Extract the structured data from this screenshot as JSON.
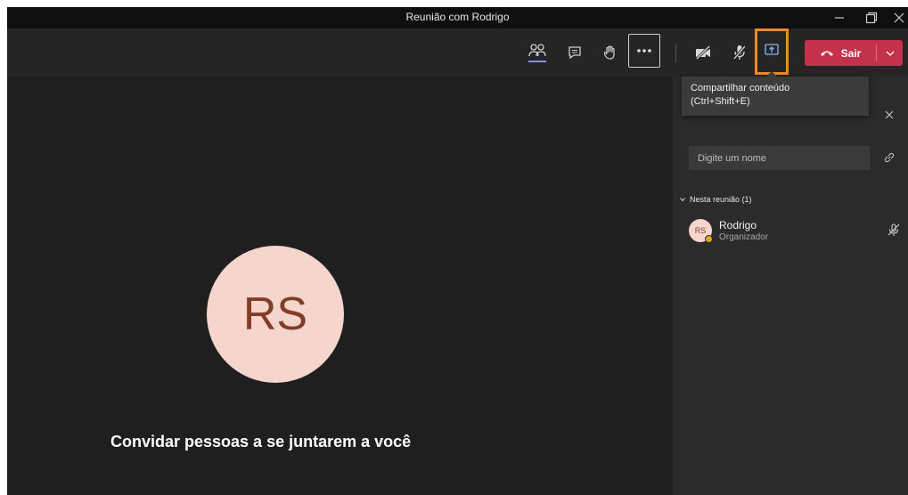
{
  "window": {
    "title": "Reunião com Rodrigo"
  },
  "toolbar": {
    "icons": [
      "participants-icon",
      "chat-icon",
      "raise-hand-icon",
      "more-options-icon",
      "camera-off-icon",
      "mic-off-icon",
      "share-screen-icon"
    ],
    "leave_label": "Sair"
  },
  "stage": {
    "avatar_initials": "RS",
    "invite_text": "Convidar pessoas a se juntarem a você"
  },
  "tooltip": {
    "line1": "Compartilhar conteúdo",
    "line2": "(Ctrl+Shift+E)"
  },
  "panel": {
    "search_placeholder": "Digite um nome",
    "section_label": "Nesta reunião (1)",
    "participants": [
      {
        "initials": "RS",
        "name": "Rodrigo",
        "role": "Organizador"
      }
    ]
  },
  "colors": {
    "leave_button": "#c4314b",
    "highlight_box": "#f08a24",
    "avatar_bg": "#f6d6cc",
    "avatar_text": "#823d27"
  }
}
